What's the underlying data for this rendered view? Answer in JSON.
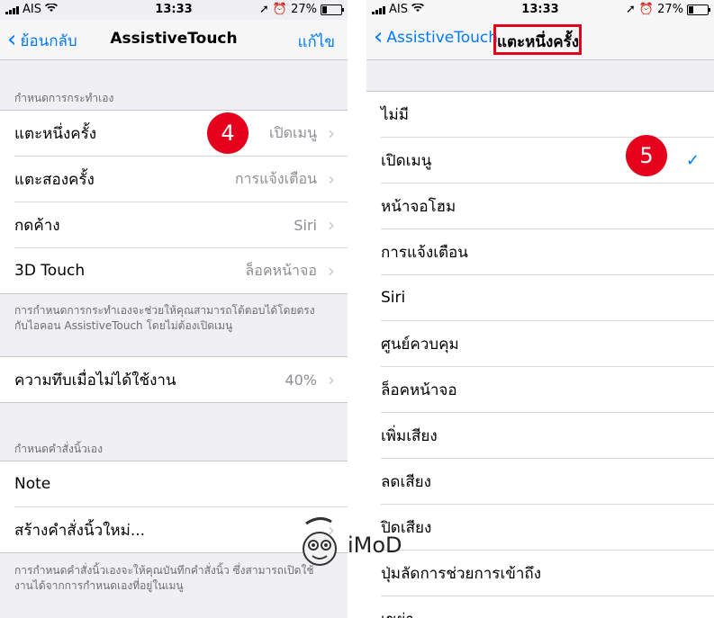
{
  "colors": {
    "accent": "#007aff",
    "badge": "#e5001c",
    "background": "#efeff4"
  },
  "left": {
    "status": {
      "carrier": "AIS",
      "time": "13:33",
      "battery": "27%"
    },
    "nav": {
      "back": "ย้อนกลับ",
      "title": "AssistiveTouch",
      "edit": "แก้ไข"
    },
    "section1_header": "กำหนดการกระทำเอง",
    "actions": [
      {
        "label": "แตะหนึ่งครั้ง",
        "value": "เปิดเมนู"
      },
      {
        "label": "แตะสองครั้ง",
        "value": "การแจ้งเตือน"
      },
      {
        "label": "กดค้าง",
        "value": "Siri"
      },
      {
        "label": "3D Touch",
        "value": "ล็อคหน้าจอ"
      }
    ],
    "footer1_line1": "การกำหนดการกระทำเองจะช่วยให้คุณสามารถโต้ตอบได้โดยตรง",
    "footer1_line2": "กับไอคอน AssistiveTouch โดยไม่ต้องเปิดเมนู",
    "opacity": {
      "label": "ความทึบเมื่อไม่ได้ใช้งาน",
      "value": "40%"
    },
    "section2_header": "กำหนดคำสั่งนิ้วเอง",
    "gestures": [
      {
        "label": "Note"
      },
      {
        "label": "สร้างคำสั่งนิ้วใหม่..."
      }
    ],
    "footer2_line1": "การกำหนดคำสั่งนิ้วเองจะให้คุณบันทึกคำสั่งนิ้ว ซึ่งสามารถเปิดใช้",
    "footer2_line2": "งานได้จากการกำหนดเองที่อยู่ในเมนู",
    "badge": "4"
  },
  "right": {
    "status": {
      "carrier": "AIS",
      "time": "13:33",
      "battery": "27%"
    },
    "nav": {
      "back": "AssistiveTouch",
      "title": "แตะหนึ่งครั้ง"
    },
    "options": [
      "ไม่มี",
      "เปิดเมนู",
      "หน้าจอโฮม",
      "การแจ้งเตือน",
      "Siri",
      "ศูนย์ควบคุม",
      "ล็อคหน้าจอ",
      "เพิ่มเสียง",
      "ลดเสียง",
      "ปิดเสียง",
      "ปุ่มลัดการช่วยการเข้าถึง",
      "เขย่า"
    ],
    "selected_index": 1,
    "badge": "5"
  },
  "logo": {
    "text": "iMoD",
    "icon": "monkey-logo-icon"
  }
}
